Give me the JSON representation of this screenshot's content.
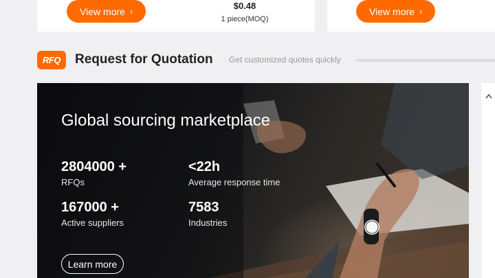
{
  "product_cards": {
    "left": {
      "view_label": "View more",
      "price": "$0.48",
      "moq": "1 piece(MOQ)"
    },
    "right": {
      "view_label": "View more"
    }
  },
  "icons": {
    "view_more_chevron": "chevron-right-icon"
  },
  "rfq": {
    "logo_text": "RFQ",
    "title": "Request for Quotation",
    "subtitle": "Get customized quotes quickly"
  },
  "banner": {
    "title": "Global sourcing marketplace",
    "stats": [
      {
        "value": "2804000 +",
        "label": "RFQs"
      },
      {
        "value": "<22h",
        "label": "Average response time"
      },
      {
        "value": "167000 +",
        "label": "Active suppliers"
      },
      {
        "value": "7583",
        "label": "Industries"
      }
    ],
    "learn_more_label": "Learn more"
  },
  "colors": {
    "accent": "#ff6a00",
    "page_background": "#f0f0f2",
    "banner_dark": "#0c0c0e"
  }
}
